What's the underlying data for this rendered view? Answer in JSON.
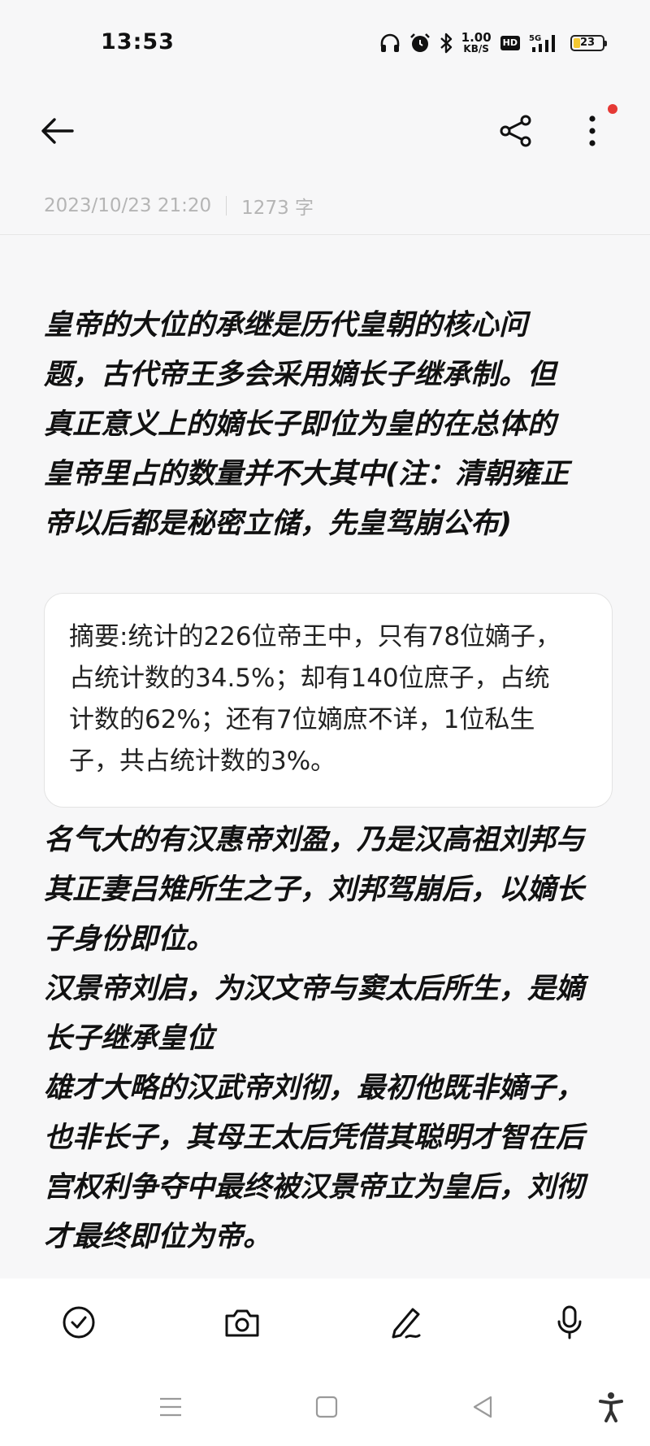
{
  "status_bar": {
    "time": "13:53",
    "net_speed_value": "1.00",
    "net_speed_unit": "KB/S",
    "hd_label": "HD",
    "signal_label": "5G",
    "battery_level": "23",
    "battery_fraction": 0.23,
    "battery_color": "#f3c730",
    "icons": [
      "headphones-icon",
      "alarm-icon",
      "bluetooth-icon",
      "hd-icon",
      "signal-icon",
      "battery-icon"
    ]
  },
  "toolbar": {
    "icons": [
      "back-arrow-icon",
      "share-icon",
      "more-vert-icon"
    ],
    "notification_dot_color": "#e53935"
  },
  "meta": {
    "date": "2023/10/23 21:20",
    "word_count": "1273 字"
  },
  "note": {
    "intro": "皇帝的大位的承继是历代皇朝的核心问\n题，古代帝王多会采用嫡长子继承制。但\n真正意义上的嫡长子即位为皇的在总体的\n皇帝里占的数量并不大其中(注：清朝雍正\n帝以后都是秘密立储，先皇驾崩公布)",
    "summary": "摘要:统计的226位帝王中，只有78位嫡子，\n占统计数的34.5%；却有140位庶子，占统\n计数的62%；还有7位嫡庶不详，1位私生\n子，共占统计数的3%。",
    "body": "名气大的有汉惠帝刘盈，乃是汉高祖刘邦与\n其正妻吕雉所生之子，刘邦驾崩后，以嫡长\n子身份即位。\n汉景帝刘启，为汉文帝与窦太后所生，是嫡\n长子继承皇位\n雄才大略的汉武帝刘彻，最初他既非嫡子，\n也非长子，其母王太后凭借其聪明才智在后\n宫权利争夺中最终被汉景帝立为皇后，刘彻\n才最终即位为帝。"
  },
  "bottom_tools": [
    "checklist-icon",
    "camera-icon",
    "pen-icon",
    "microphone-icon"
  ],
  "navbar": [
    "menu-icon",
    "home-icon",
    "back-icon",
    "accessibility-icon"
  ]
}
